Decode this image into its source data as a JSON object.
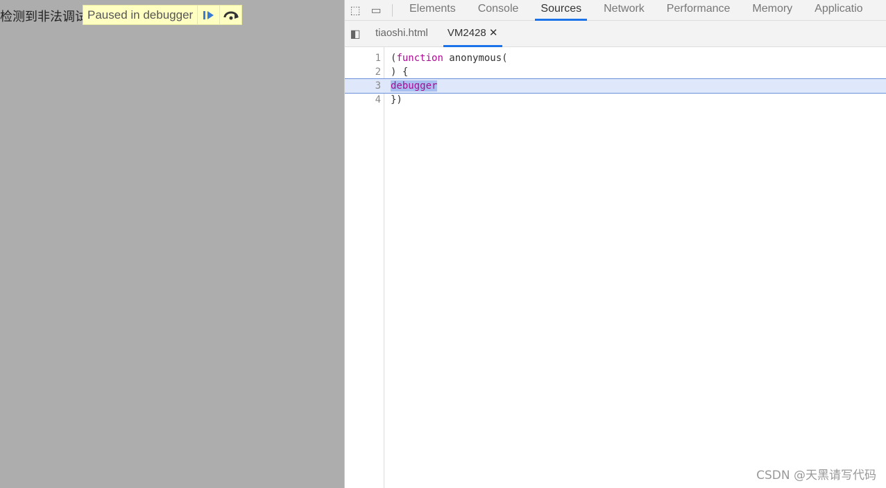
{
  "page": {
    "text": "检测到非法调试"
  },
  "overlay": {
    "message": "Paused in debugger",
    "resume_icon": "resume-icon",
    "step_over_icon": "step-over-icon"
  },
  "devtools": {
    "tabs": [
      "Elements",
      "Console",
      "Sources",
      "Network",
      "Performance",
      "Memory",
      "Applicatio"
    ],
    "active_tab": "Sources",
    "file_tabs": [
      "tiaoshi.html",
      "VM2428"
    ],
    "close_glyph": "✕",
    "code": [
      {
        "n": "1",
        "pre": "(",
        "kw": "function",
        "post": " anonymous("
      },
      {
        "n": "2",
        "text": ") {"
      },
      {
        "n": "3",
        "dbg": "debugger"
      },
      {
        "n": "4",
        "text": "})"
      }
    ]
  },
  "watermark": "CSDN @天黑请写代码",
  "colors": {
    "accent": "#1a73e8",
    "overlay_bg": "#ffffc2",
    "highlight": "#dfe7fb"
  }
}
